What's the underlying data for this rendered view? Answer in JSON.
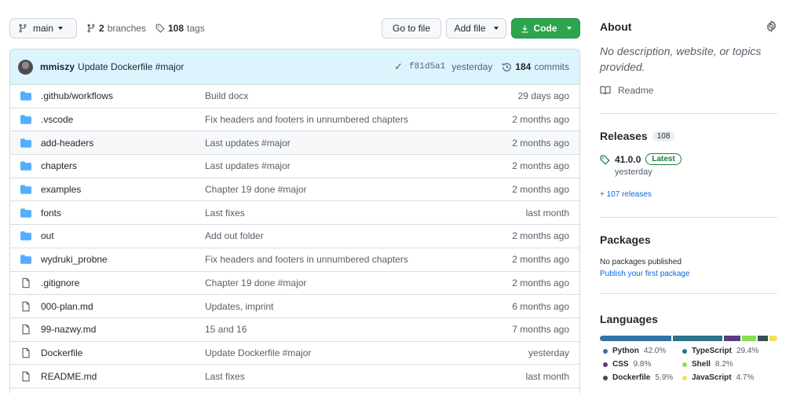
{
  "toolbar": {
    "branch_label": "main",
    "branches_count": "2",
    "branches_label": "branches",
    "tags_count": "108",
    "tags_label": "tags",
    "goto_file": "Go to file",
    "add_file": "Add file",
    "code": "Code"
  },
  "commit": {
    "author": "mmiszy",
    "message": "Update Dockerfile #major",
    "sha": "f81d5a1",
    "time": "yesterday",
    "commits_count": "184",
    "commits_label": "commits"
  },
  "files": [
    {
      "type": "folder",
      "name": ".github/workflows",
      "message": "Build docx",
      "age": "29 days ago"
    },
    {
      "type": "folder",
      "name": ".vscode",
      "message": "Fix headers and footers in unnumbered chapters",
      "age": "2 months ago"
    },
    {
      "type": "folder",
      "name": "add-headers",
      "message": "Last updates #major",
      "age": "2 months ago"
    },
    {
      "type": "folder",
      "name": "chapters",
      "message": "Last updates #major",
      "age": "2 months ago"
    },
    {
      "type": "folder",
      "name": "examples",
      "message": "Chapter 19 done #major",
      "age": "2 months ago"
    },
    {
      "type": "folder",
      "name": "fonts",
      "message": "Last fixes",
      "age": "last month"
    },
    {
      "type": "folder",
      "name": "out",
      "message": "Add out folder",
      "age": "2 months ago"
    },
    {
      "type": "folder",
      "name": "wydruki_probne",
      "message": "Fix headers and footers in unnumbered chapters",
      "age": "2 months ago"
    },
    {
      "type": "file",
      "name": ".gitignore",
      "message": "Chapter 19 done #major",
      "age": "2 months ago"
    },
    {
      "type": "file",
      "name": "000-plan.md",
      "message": "Updates, imprint",
      "age": "6 months ago"
    },
    {
      "type": "file",
      "name": "99-nazwy.md",
      "message": "15 and 16",
      "age": "7 months ago"
    },
    {
      "type": "file",
      "name": "Dockerfile",
      "message": "Update Dockerfile #major",
      "age": "yesterday"
    },
    {
      "type": "file",
      "name": "README.md",
      "message": "Last fixes",
      "age": "last month"
    }
  ],
  "about": {
    "title": "About",
    "description": "No description, website, or topics provided.",
    "readme": "Readme"
  },
  "releases": {
    "title": "Releases",
    "count": "108",
    "version": "41.0.0",
    "badge": "Latest",
    "date": "yesterday",
    "more": "+ 107 releases"
  },
  "packages": {
    "title": "Packages",
    "none": "No packages published",
    "link": "Publish your first package"
  },
  "languages": {
    "title": "Languages",
    "items": [
      {
        "name": "Python",
        "percent": "42.0%",
        "value": 42.0,
        "color": "#3572A5"
      },
      {
        "name": "TypeScript",
        "percent": "29.4%",
        "value": 29.4,
        "color": "#2b7489"
      },
      {
        "name": "CSS",
        "percent": "9.8%",
        "value": 9.8,
        "color": "#563d7c"
      },
      {
        "name": "Shell",
        "percent": "8.2%",
        "value": 8.2,
        "color": "#89e051"
      },
      {
        "name": "Dockerfile",
        "percent": "5.9%",
        "value": 5.9,
        "color": "#384d54"
      },
      {
        "name": "JavaScript",
        "percent": "4.7%",
        "value": 4.7,
        "color": "#f1e05a"
      }
    ]
  }
}
